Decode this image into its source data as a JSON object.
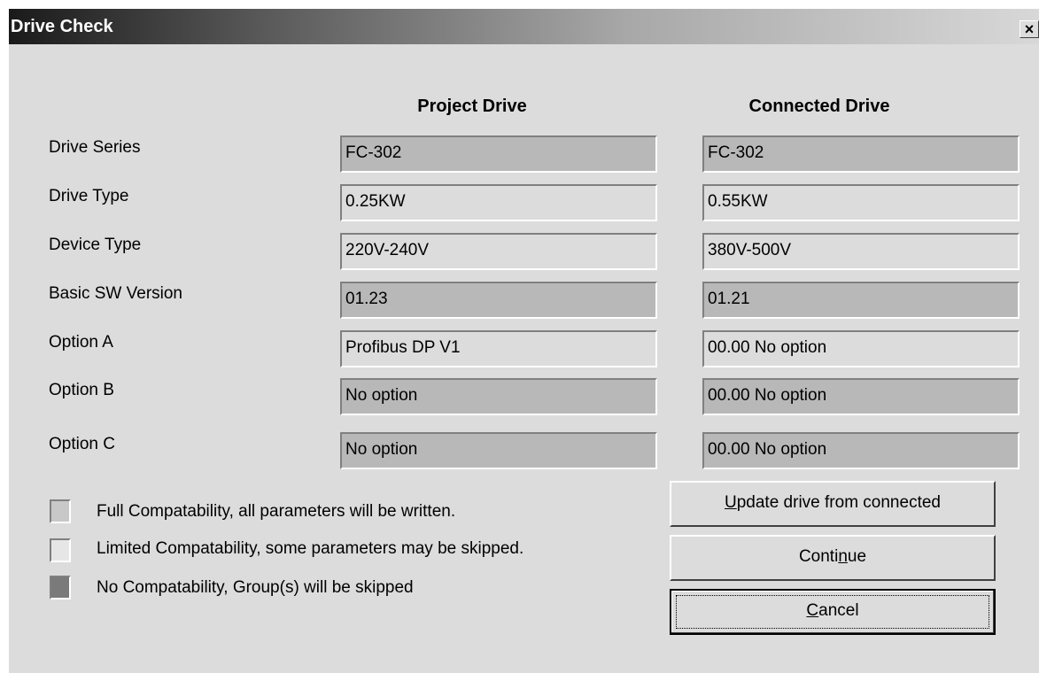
{
  "window": {
    "title": "Drive Check",
    "close_glyph": "×"
  },
  "columns": {
    "project": "Project Drive",
    "connected": "Connected Drive"
  },
  "rows": [
    {
      "label": "Drive Series",
      "project": "FC-302",
      "connected": "FC-302",
      "shade": "gray"
    },
    {
      "label": "Drive Type",
      "project": "0.25KW",
      "connected": "0.55KW",
      "shade": "light"
    },
    {
      "label": "Device Type",
      "project": "220V-240V",
      "connected": "380V-500V",
      "shade": "light"
    },
    {
      "label": "Basic SW Version",
      "project": "01.23",
      "connected": "01.21",
      "shade": "gray"
    },
    {
      "label": "Option A",
      "project": "Profibus DP V1",
      "connected": "00.00 No option",
      "shade": "light"
    },
    {
      "label": "Option B",
      "project": "No option",
      "connected": "00.00 No option",
      "shade": "gray"
    },
    {
      "label": "Option C",
      "project": "No option",
      "connected": "00.00 No option",
      "shade": "gray"
    }
  ],
  "legend": [
    {
      "text": "Full Compatability, all parameters will be written.",
      "color": "#c8c8c8"
    },
    {
      "text": "Limited Compatability, some parameters may be skipped.",
      "color": "#e6e6e6"
    },
    {
      "text": "No Compatability, Group(s) will be skipped",
      "color": "#7a7a7a"
    }
  ],
  "buttons": {
    "update": {
      "pre": "",
      "ul": "U",
      "post": "pdate drive from connected"
    },
    "continue": {
      "pre": "Conti",
      "ul": "n",
      "post": "ue"
    },
    "cancel": {
      "pre": "",
      "ul": "C",
      "post": "ancel"
    }
  }
}
